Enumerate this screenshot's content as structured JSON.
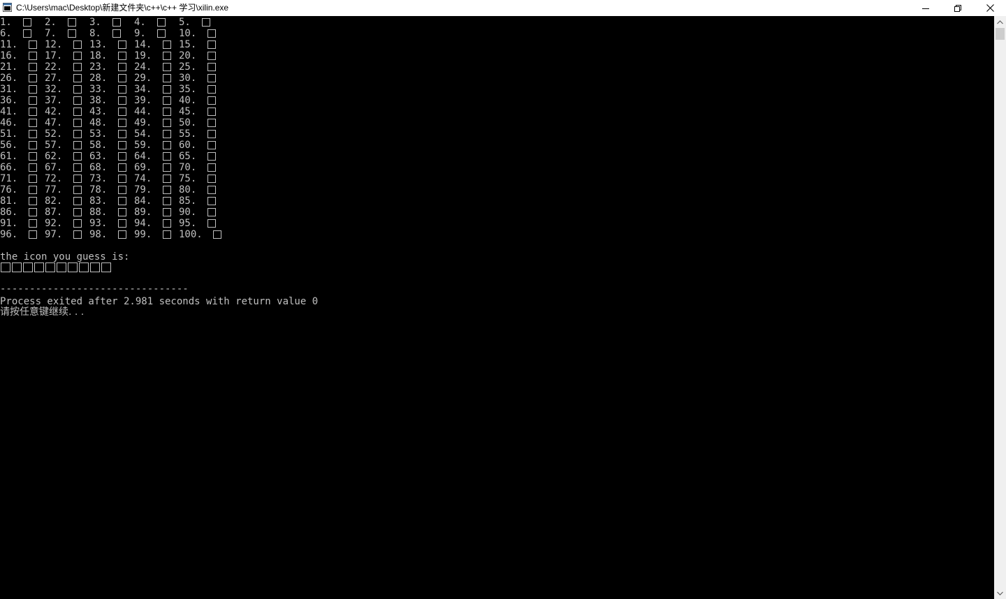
{
  "window": {
    "title": "C:\\Users\\mac\\Desktop\\新建文件夹\\c++\\c++ 学习\\xilin.exe",
    "icon": "console-app-icon",
    "controls": [
      "minimize-icon",
      "maximize-icon",
      "close-icon"
    ]
  },
  "console": {
    "grid_labels": [
      "1.",
      "2.",
      "3.",
      "4.",
      "5.",
      "6.",
      "7.",
      "8.",
      "9.",
      "10.",
      "11.",
      "12.",
      "13.",
      "14.",
      "15.",
      "16.",
      "17.",
      "18.",
      "19.",
      "20.",
      "21.",
      "22.",
      "23.",
      "24.",
      "25.",
      "26.",
      "27.",
      "28.",
      "29.",
      "30.",
      "31.",
      "32.",
      "33.",
      "34.",
      "35.",
      "36.",
      "37.",
      "38.",
      "39.",
      "40.",
      "41.",
      "42.",
      "43.",
      "44.",
      "45.",
      "46.",
      "47.",
      "48.",
      "49.",
      "50.",
      "51.",
      "52.",
      "53.",
      "54.",
      "55.",
      "56.",
      "57.",
      "58.",
      "59.",
      "60.",
      "61.",
      "62.",
      "63.",
      "64.",
      "65.",
      "66.",
      "67.",
      "68.",
      "69.",
      "70.",
      "71.",
      "72.",
      "73.",
      "74.",
      "75.",
      "76.",
      "77.",
      "78.",
      "79.",
      "80.",
      "81.",
      "82.",
      "83.",
      "84.",
      "85.",
      "86.",
      "87.",
      "88.",
      "89.",
      "90.",
      "91.",
      "92.",
      "93.",
      "94.",
      "95.",
      "96.",
      "97.",
      "98.",
      "99.",
      "100."
    ],
    "guess_prompt": "the icon you guess is:",
    "guess_box_count": 10,
    "separator": "--------------------------------",
    "exit_message": "Process exited after 2.981 seconds with return value 0",
    "continue_prompt": "请按任意键继续. . ."
  },
  "colors": {
    "console_background": "#000000",
    "console_text": "#c0c0c0",
    "titlebar_background": "#ffffff"
  }
}
